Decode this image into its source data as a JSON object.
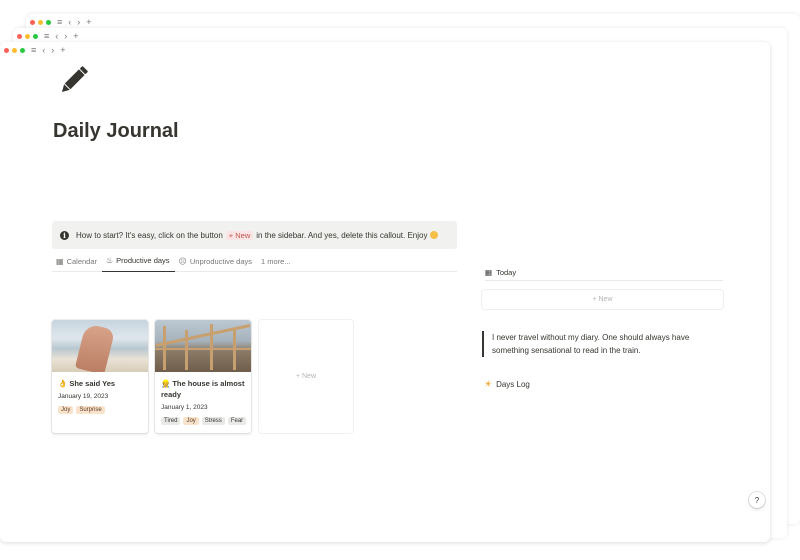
{
  "windows": {
    "titlebar_icons": {
      "menu": "≡",
      "back": "‹",
      "forward": "›",
      "new_tab": "+"
    }
  },
  "page": {
    "icon": "pencil-icon",
    "title": "Daily Journal"
  },
  "callout": {
    "icon": "info-icon",
    "text_before": "How to start? It's easy, click on the button",
    "chip": "+ New",
    "text_after": "in the sidebar. And yes, delete this callout. Enjoy",
    "emoji": "grinning-face-emoji"
  },
  "tabs": [
    {
      "icon": "calendar-icon",
      "glyph": "▦",
      "label": "Calendar"
    },
    {
      "icon": "fire-icon",
      "glyph": "♨",
      "label": "Productive days",
      "active": true
    },
    {
      "icon": "smiley-icon",
      "glyph": "☹",
      "label": "Unproductive days"
    },
    {
      "label": "1 more..."
    }
  ],
  "cards": [
    {
      "emoji": "👌",
      "title": "She said Yes",
      "date": "January 19, 2023",
      "tags": [
        {
          "label": "Joy",
          "color": "orange"
        },
        {
          "label": "Surprise",
          "color": "orange"
        }
      ]
    },
    {
      "emoji": "👷",
      "title": "The house is almost ready",
      "date": "January 1, 2023",
      "tags": [
        {
          "label": "Tired",
          "color": "gray"
        },
        {
          "label": "Joy",
          "color": "orange"
        },
        {
          "label": "Stress",
          "color": "gray"
        },
        {
          "label": "Fear",
          "color": "gray"
        }
      ]
    }
  ],
  "new_card": {
    "label": "+ New"
  },
  "today": {
    "icon": "grid-icon",
    "label": "Today",
    "new_label": "+ New"
  },
  "quote": "I never travel without my diary. One should always have something sensational to read in the train.",
  "days_log": {
    "icon": "sun-icon",
    "label": "Days Log"
  },
  "help": {
    "label": "?"
  }
}
